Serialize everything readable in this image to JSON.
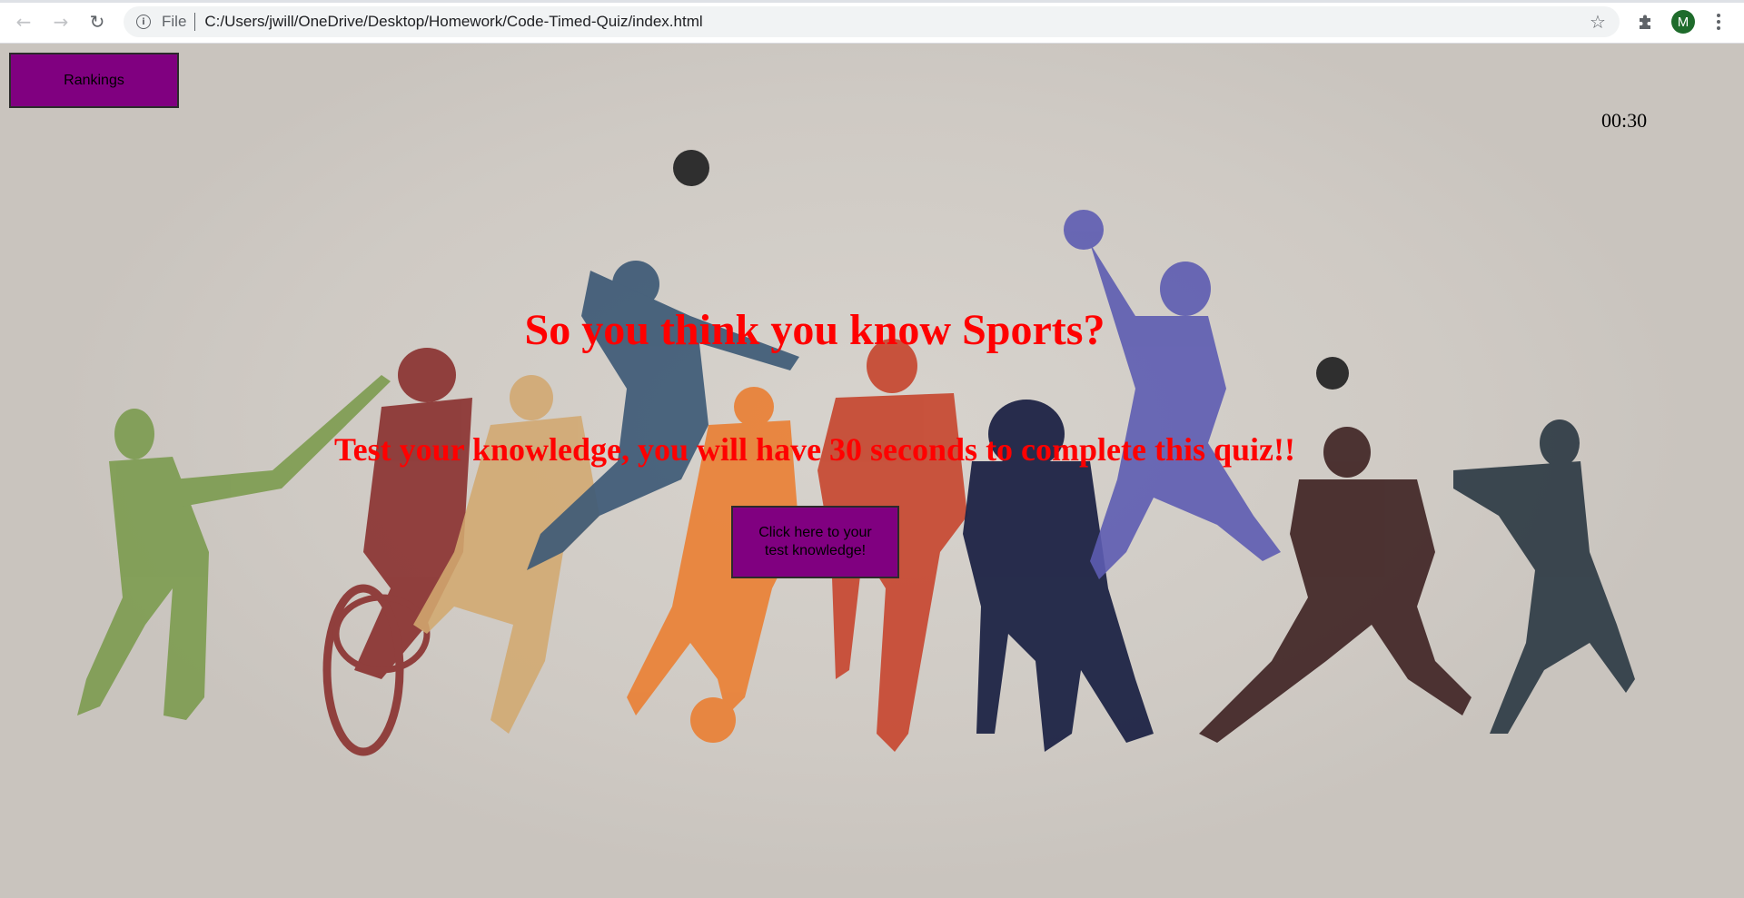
{
  "browser": {
    "scheme_label": "File",
    "url": "C:/Users/jwill/OneDrive/Desktop/Homework/Code-Timed-Quiz/index.html",
    "avatar_initial": "M",
    "icons": [
      "back-arrow-icon",
      "forward-arrow-icon",
      "reload-icon",
      "info-icon",
      "star-icon",
      "extensions-puzzle-icon",
      "menu-kebab-icon"
    ]
  },
  "page": {
    "rankings_label": "Rankings",
    "timer": "00:30",
    "title": "So you think you know Sports?",
    "subtitle": "Test your knowledge, you will have 30 seconds to complete this quiz!!",
    "start_label": "Click here to your test knowledge!"
  },
  "colors": {
    "button_purple": "#800080",
    "heading_red": "#ff0000",
    "avatar_green": "#1e6b2b"
  }
}
